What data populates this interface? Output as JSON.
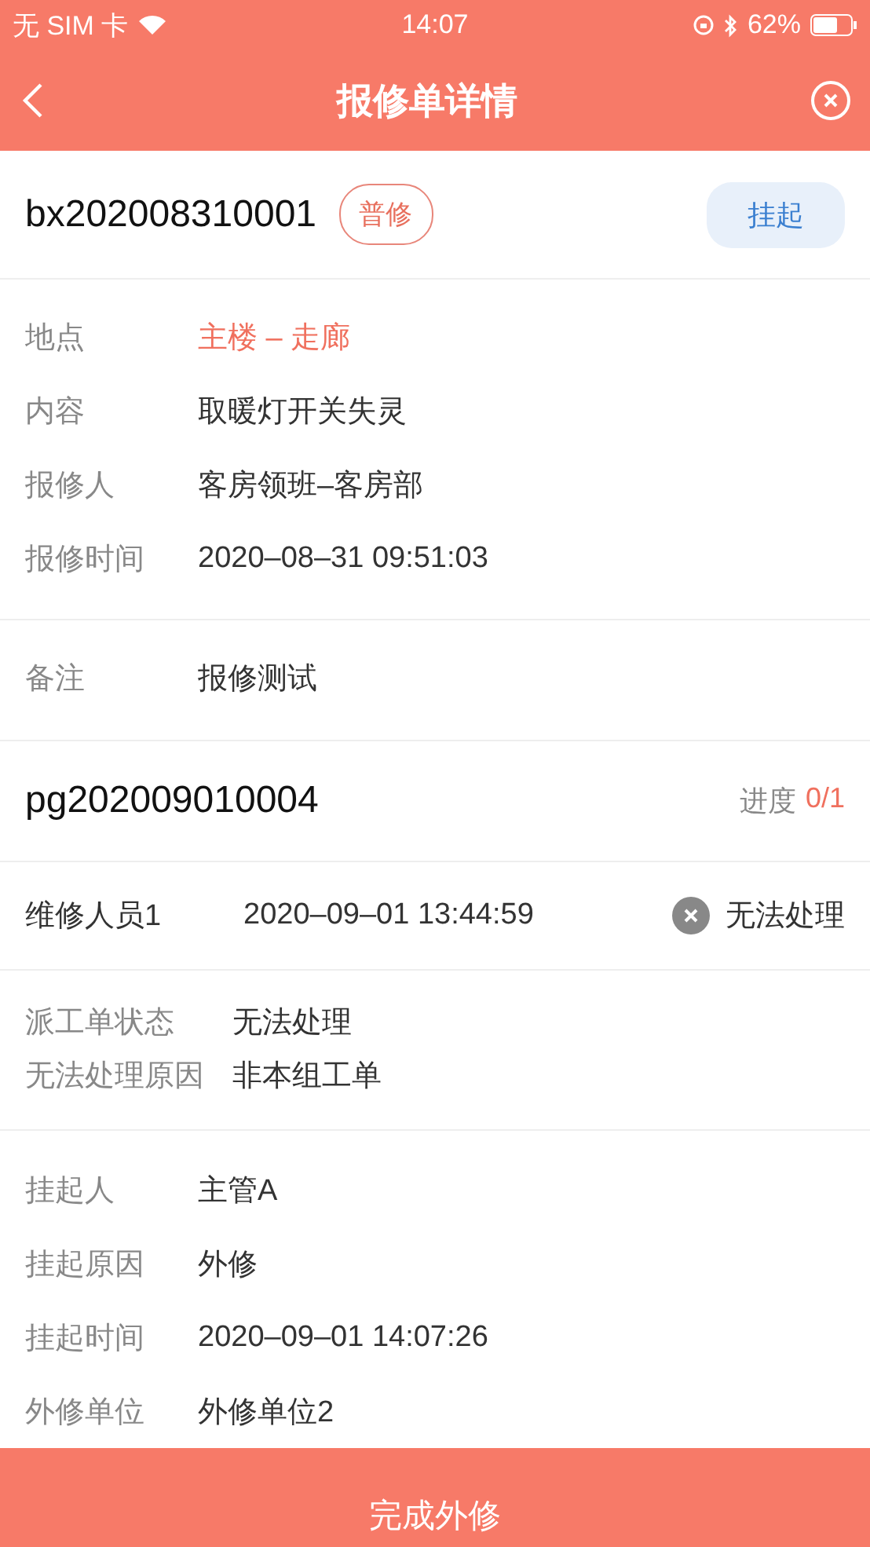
{
  "status_bar": {
    "carrier": "无 SIM 卡",
    "time": "14:07",
    "battery": "62%"
  },
  "nav": {
    "title": "报修单详情"
  },
  "order": {
    "number": "bx202008310001",
    "tag": "普修",
    "action": "挂起",
    "fields": [
      {
        "label": "地点",
        "value": "主楼 – 走廊",
        "emphasis": true
      },
      {
        "label": "内容",
        "value": "取暖灯开关失灵",
        "emphasis": false
      },
      {
        "label": "报修人",
        "value": "客房领班–客房部",
        "emphasis": false
      },
      {
        "label": "报修时间",
        "value": "2020–08–31 09:51:03",
        "emphasis": false
      }
    ],
    "remark": {
      "label": "备注",
      "value": "报修测试"
    }
  },
  "dispatch": {
    "number": "pg202009010004",
    "progress_label": "进度",
    "progress_value": "0/1",
    "worker": {
      "name": "维修人员1",
      "time": "2020–09–01 13:44:59",
      "result": "无法处理"
    },
    "status_fields": [
      {
        "label": "派工单状态",
        "value": "无法处理"
      },
      {
        "label": "无法处理原因",
        "value": "非本组工单"
      }
    ],
    "suspend_fields": [
      {
        "label": "挂起人",
        "value": "主管A"
      },
      {
        "label": "挂起原因",
        "value": "外修"
      },
      {
        "label": "挂起时间",
        "value": "2020–09–01 14:07:26"
      },
      {
        "label": "外修单位",
        "value": "外修单位2"
      }
    ]
  },
  "footer_button": "完成外修"
}
